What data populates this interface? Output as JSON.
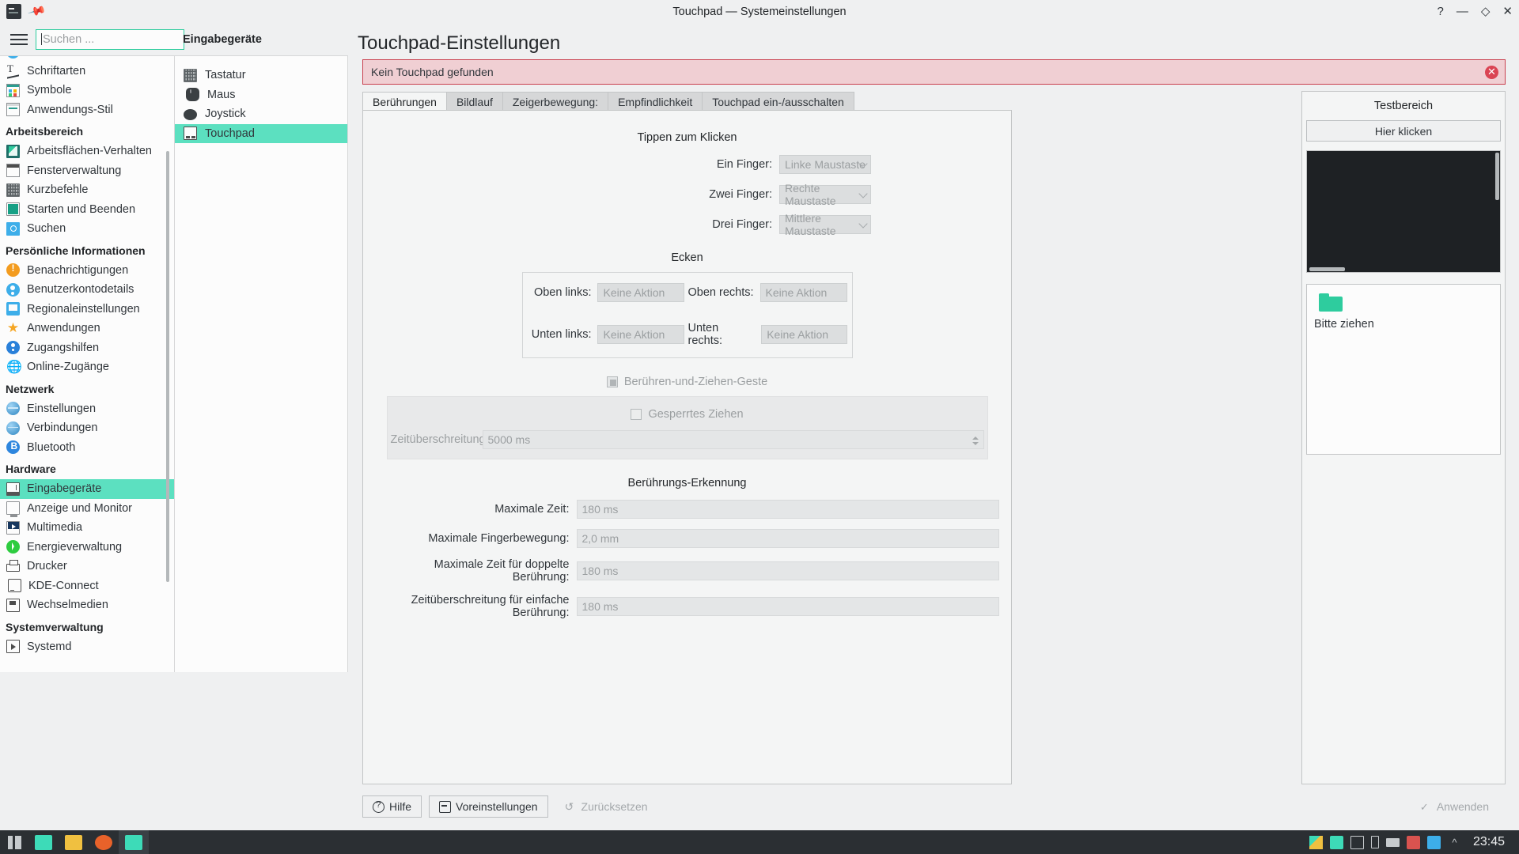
{
  "window": {
    "title": "Touchpad — Systemeinstellungen",
    "controls": {
      "help": "?",
      "minimize": "—",
      "maximize": "◇",
      "close": "✕"
    },
    "app_icon": "systemsettings-icon",
    "pin_icon": "pin-icon"
  },
  "toolbar": {
    "menu_icon": "hamburger-menu-icon",
    "search_placeholder": "Suchen ...",
    "search_value": ""
  },
  "sidebar": {
    "scroll_position": "middle",
    "groups": [
      {
        "label": "",
        "items": [
          {
            "label": "Schriftarten",
            "icon": "fonts-icon",
            "selected": false
          },
          {
            "label": "Symbole",
            "icon": "icons-icon",
            "selected": false
          },
          {
            "label": "Anwendungs-Stil",
            "icon": "application-style-icon",
            "selected": false
          }
        ]
      },
      {
        "label": "Arbeitsbereich",
        "items": [
          {
            "label": "Arbeitsflächen-Verhalten",
            "icon": "desktop-behavior-icon",
            "selected": false
          },
          {
            "label": "Fensterverwaltung",
            "icon": "window-management-icon",
            "selected": false
          },
          {
            "label": "Kurzbefehle",
            "icon": "shortcuts-icon",
            "selected": false
          },
          {
            "label": "Starten und Beenden",
            "icon": "startup-shutdown-icon",
            "selected": false
          },
          {
            "label": "Suchen",
            "icon": "search-module-icon",
            "selected": false
          }
        ]
      },
      {
        "label": "Persönliche Informationen",
        "items": [
          {
            "label": "Benachrichtigungen",
            "icon": "notifications-icon",
            "selected": false
          },
          {
            "label": "Benutzerkontodetails",
            "icon": "user-account-icon",
            "selected": false
          },
          {
            "label": "Regionaleinstellungen",
            "icon": "regional-settings-icon",
            "selected": false
          },
          {
            "label": "Anwendungen",
            "icon": "applications-star-icon",
            "selected": false
          },
          {
            "label": "Zugangshilfen",
            "icon": "accessibility-icon",
            "selected": false
          },
          {
            "label": "Online-Zugänge",
            "icon": "online-accounts-globe-icon",
            "selected": false
          }
        ]
      },
      {
        "label": "Netzwerk",
        "items": [
          {
            "label": "Einstellungen",
            "icon": "network-settings-globe-icon",
            "selected": false
          },
          {
            "label": "Verbindungen",
            "icon": "network-connections-globe-icon",
            "selected": false
          },
          {
            "label": "Bluetooth",
            "icon": "bluetooth-icon",
            "selected": false
          }
        ]
      },
      {
        "label": "Hardware",
        "items": [
          {
            "label": "Eingabegeräte",
            "icon": "input-devices-icon",
            "selected": true
          },
          {
            "label": "Anzeige und Monitor",
            "icon": "display-monitor-icon",
            "selected": false
          },
          {
            "label": "Multimedia",
            "icon": "multimedia-icon",
            "selected": false
          },
          {
            "label": "Energieverwaltung",
            "icon": "power-management-icon",
            "selected": false
          },
          {
            "label": "Drucker",
            "icon": "printer-icon",
            "selected": false
          },
          {
            "label": "KDE-Connect",
            "icon": "kdeconnect-icon",
            "selected": false
          },
          {
            "label": "Wechselmedien",
            "icon": "removable-media-icon",
            "selected": false
          }
        ]
      },
      {
        "label": "Systemverwaltung",
        "items": [
          {
            "label": "Systemd",
            "icon": "systemd-icon",
            "selected": false
          }
        ]
      }
    ]
  },
  "device_column": {
    "header": "Eingabegeräte",
    "items": [
      {
        "label": "Tastatur",
        "icon": "keyboard-icon",
        "selected": false
      },
      {
        "label": "Maus",
        "icon": "mouse-icon",
        "selected": false
      },
      {
        "label": "Joystick",
        "icon": "joystick-icon",
        "selected": false
      },
      {
        "label": "Touchpad",
        "icon": "touchpad-icon",
        "selected": true
      }
    ]
  },
  "main": {
    "page_title": "Touchpad-Einstellungen",
    "error": {
      "message": "Kein Touchpad gefunden",
      "close_icon": "close-circle-icon",
      "border_color": "#c9414f",
      "background_color": "#f0cfd3"
    },
    "tabs": [
      {
        "label": "Berührungen",
        "active": true
      },
      {
        "label": "Bildlauf",
        "active": false
      },
      {
        "label": "Zeigerbewegung:",
        "active": false
      },
      {
        "label": "Empfindlichkeit",
        "active": false
      },
      {
        "label": "Touchpad ein-/ausschalten",
        "active": false
      }
    ],
    "tap_to_click": {
      "title": "Tippen zum Klicken",
      "rows": [
        {
          "label": "Ein Finger:",
          "value": "Linke Maustaste",
          "disabled": true
        },
        {
          "label": "Zwei Finger:",
          "value": "Rechte Maustaste",
          "disabled": true
        },
        {
          "label": "Drei Finger:",
          "value": "Mittlere Maustaste",
          "disabled": true
        }
      ]
    },
    "corners": {
      "title": "Ecken",
      "rows": [
        [
          {
            "label": "Oben links:",
            "value": "Keine Aktion",
            "disabled": true
          },
          {
            "label": "Oben rechts:",
            "value": "Keine Aktion",
            "disabled": true
          }
        ],
        [
          {
            "label": "Unten links:",
            "value": "Keine Aktion",
            "disabled": true
          },
          {
            "label": "Unten rechts:",
            "value": "Keine Aktion",
            "disabled": true
          }
        ]
      ]
    },
    "tap_and_drag": {
      "label": "Berühren-und-Ziehen-Geste",
      "state": "partial",
      "disabled": true
    },
    "lock_drag": {
      "label": "Gesperrtes Ziehen",
      "state": "unchecked",
      "disabled": true,
      "timeout_label": "Zeitüberschreitung:",
      "timeout_value": "5000 ms"
    },
    "tap_detection": {
      "title": "Berührungs-Erkennung",
      "rows": [
        {
          "label": "Maximale Zeit:",
          "value": "180 ms",
          "disabled": true
        },
        {
          "label": "Maximale Fingerbewegung:",
          "value": "2,0 mm",
          "disabled": true
        },
        {
          "label": "Maximale Zeit für doppelte Berührung:",
          "value": "180 ms",
          "disabled": true
        },
        {
          "label": "Zeitüberschreitung für einfache Berührung:",
          "value": "180 ms",
          "disabled": true
        }
      ]
    },
    "buttons": [
      {
        "label": "Hilfe",
        "icon": "help-icon",
        "disabled": false
      },
      {
        "label": "Voreinstellungen",
        "icon": "defaults-icon",
        "disabled": false
      },
      {
        "label": "Zurücksetzen",
        "icon": "reset-icon",
        "disabled": true
      }
    ],
    "apply_button": {
      "label": "Anwenden",
      "icon": "check-icon",
      "disabled": true
    }
  },
  "test_panel": {
    "title": "Testbereich",
    "click_button": "Hier klicken",
    "drag_label": "Bitte ziehen",
    "folder_icon": "folder-icon",
    "dark_area_color": "#1e2124"
  },
  "taskbar": {
    "launcher_icon": "kde-launcher-icon",
    "tasks": [
      {
        "icon": "dolphin-teal-icon",
        "active": false,
        "color": "#3ddbb8"
      },
      {
        "icon": "file-manager-icon",
        "active": false,
        "color": "#f0c040"
      },
      {
        "icon": "firefox-icon",
        "active": false,
        "color": "#e8622a"
      },
      {
        "icon": "systemsettings-icon",
        "active": true,
        "color": "#3ddbb8"
      }
    ],
    "tray": [
      "pencil-icon",
      "archive-icon",
      "display-icon",
      "battery-icon",
      "printer-icon",
      "package-icon",
      "volume-icon",
      "chevron-up-icon"
    ],
    "clock": "23:45",
    "background_color": "#2b2f33"
  },
  "theme": {
    "accent": "#2ecc9e",
    "selection": "#5ce0c0",
    "window_bg": "#eff0f1",
    "panel_bg": "#f4f5f5",
    "text": "#31363b"
  }
}
